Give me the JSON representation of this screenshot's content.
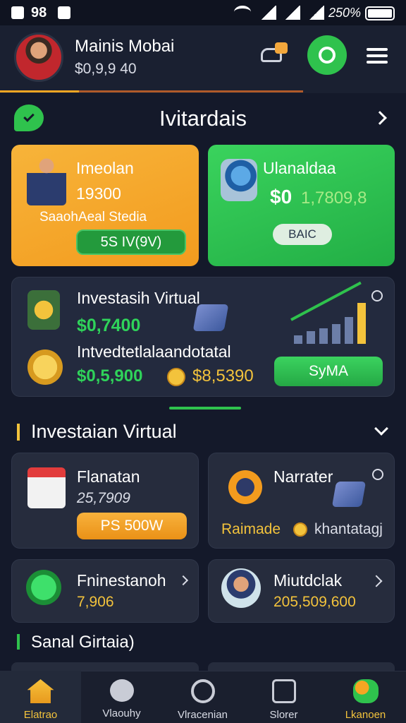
{
  "status_bar": {
    "left_text": "98",
    "right_text": "250%"
  },
  "header": {
    "user_name": "Mainis Mobai",
    "balance": "$0,9,9 40"
  },
  "banner": {
    "title": "Ivitardais"
  },
  "card_orange": {
    "title": "Imeolan",
    "amount": "19300",
    "subtitle": "SaaohAeal Stedia",
    "button_label": "5S IV(9V)"
  },
  "card_green": {
    "title": "Ulanaldaa",
    "amount_main": "$0",
    "amount_extra": "1,7809,8",
    "button_label": "BAIC"
  },
  "invest_panel": {
    "title": "Investasih Virtual",
    "value1": "$0,7400",
    "subtitle": "Intvedtetlalaandotatal",
    "value2": "$0,5,900",
    "value3": "$8,5390",
    "button_label": "SyMA"
  },
  "section1": {
    "title": "Investaian Virtual"
  },
  "grid": [
    {
      "title": "Flanatan",
      "value": "25,7909",
      "button_label": "PS 500W"
    },
    {
      "title": "Narrater",
      "label_left": "Raimade",
      "label_right": "khantatagj"
    },
    {
      "title": "Fninestanoh",
      "value": "7,906"
    },
    {
      "title": "Miutdclak",
      "value": "205,509,600"
    }
  ],
  "section2": {
    "title": "Sanal Girtaia)"
  },
  "bottom_nav": [
    {
      "label": "Elatrao"
    },
    {
      "label": "Vlaouhy"
    },
    {
      "label": "Vlracenian"
    },
    {
      "label": "Slorer"
    },
    {
      "label": "Lkanoen"
    }
  ],
  "colors": {
    "background": "#14192a",
    "orange": "#f6a623",
    "green": "#2fc24d",
    "gold": "#f3c33c",
    "card": "#262c3d"
  }
}
